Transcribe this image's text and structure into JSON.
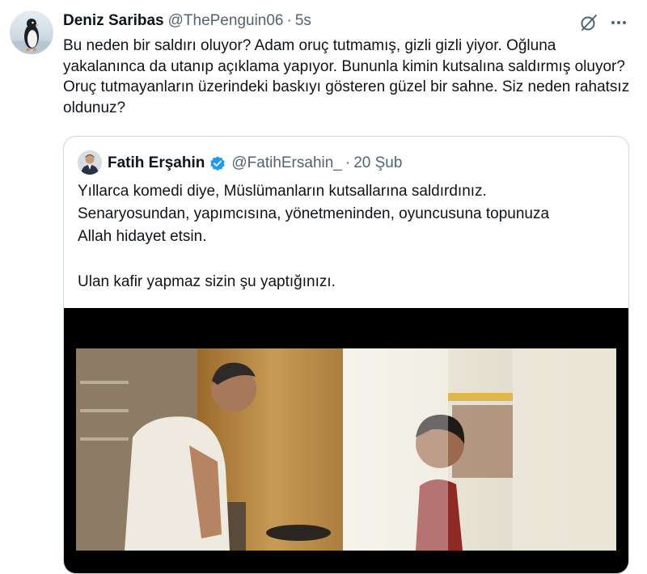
{
  "tweet": {
    "author_name": "Deniz Saribas",
    "author_handle": "@ThePenguin06",
    "separator": "·",
    "time": "5s",
    "text": "Bu neden bir saldırı oluyor? Adam oruç tutmamış, gizli gizli yiyor. Oğluna yakalanınca da utanıp açıklama yapıyor. Bununla kimin kutsalına saldırmış oluyor? Oruç tutmayanların üzerindeki baskıyı gösteren güzel bir sahne. Siz neden rahatsız oldunuz?"
  },
  "icons": {
    "grok": "grok-icon",
    "more": "more-icon",
    "verified": "verified-badge-icon"
  },
  "quote": {
    "author_name": "Fatih Erşahin",
    "author_handle": "@FatihErsahin_",
    "separator": "·",
    "date": "20 Şub",
    "paragraph1_line1": "Yıllarca komedi diye, Müslümanların kutsallarına saldırdınız.",
    "paragraph1_line2": "Senaryosundan, yapımcısına, yönetmeninden, oyuncusuna topunuza",
    "paragraph1_line3": "Allah hidayet etsin.",
    "paragraph2": "Ulan kafir yapmaz sizin şu yaptığınızı."
  },
  "colors": {
    "text": "#0f1419",
    "secondary": "#536471",
    "border": "#cfd9de",
    "verified": "#1d9bf0"
  }
}
